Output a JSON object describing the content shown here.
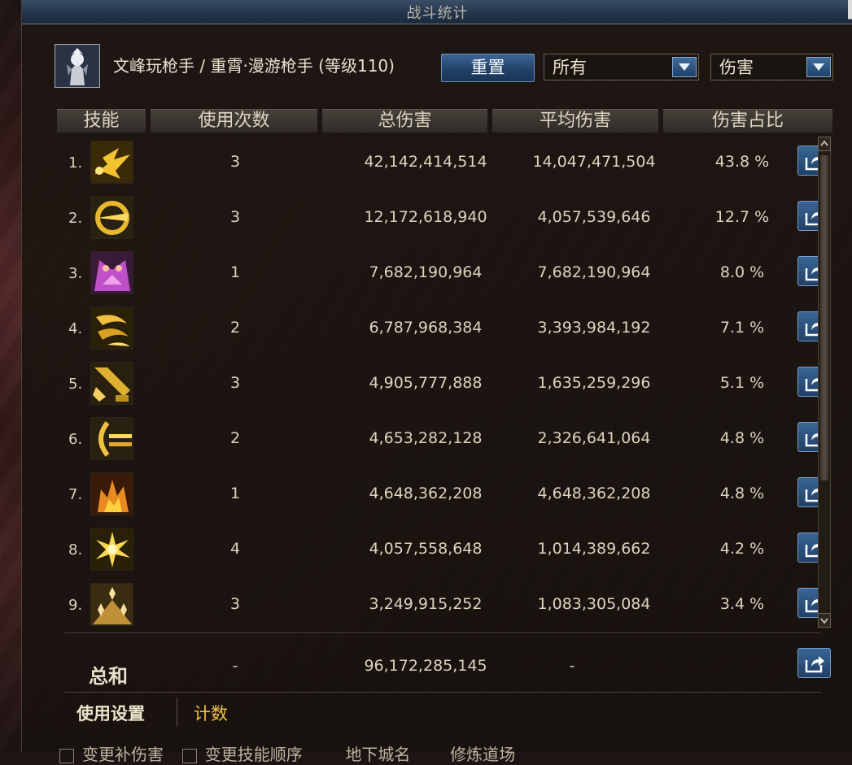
{
  "window": {
    "title": "战斗统计"
  },
  "character": {
    "name": "文峰玩枪手 / 重霄·漫游枪手 (等级110)"
  },
  "toolbar": {
    "reset_label": "重置",
    "filter_select": "所有",
    "metric_select": "伤害"
  },
  "table": {
    "columns": [
      "技能",
      "使用次数",
      "总伤害",
      "平均伤害",
      "伤害占比"
    ],
    "rows": [
      {
        "rank": "1.",
        "count": "3",
        "total": "42,142,414,514",
        "avg": "14,047,471,504",
        "pct": "43.8 %",
        "icon": "skill-burst-icon"
      },
      {
        "rank": "2.",
        "count": "3",
        "total": "12,172,618,940",
        "avg": "4,057,539,646",
        "pct": "12.7 %",
        "icon": "skill-spin-icon"
      },
      {
        "rank": "3.",
        "count": "1",
        "total": "7,682,190,964",
        "avg": "7,682,190,964",
        "pct": "8.0 %",
        "icon": "skill-awaken-icon"
      },
      {
        "rank": "4.",
        "count": "2",
        "total": "6,787,968,384",
        "avg": "3,393,984,192",
        "pct": "7.1 %",
        "icon": "skill-whirl-icon"
      },
      {
        "rank": "5.",
        "count": "3",
        "total": "4,905,777,888",
        "avg": "1,635,259,296",
        "pct": "5.1 %",
        "icon": "skill-cannon-icon"
      },
      {
        "rank": "6.",
        "count": "2",
        "total": "4,653,282,128",
        "avg": "2,326,641,064",
        "pct": "4.8 %",
        "icon": "skill-shot-icon"
      },
      {
        "rank": "7.",
        "count": "1",
        "total": "4,648,362,208",
        "avg": "4,648,362,208",
        "pct": "4.8 %",
        "icon": "skill-flame-icon"
      },
      {
        "rank": "8.",
        "count": "4",
        "total": "4,057,558,648",
        "avg": "1,014,389,662",
        "pct": "4.2 %",
        "icon": "skill-flash-icon"
      },
      {
        "rank": "9.",
        "count": "3",
        "total": "3,249,915,252",
        "avg": "1,083,305,084",
        "pct": "3.4 %",
        "icon": "skill-mine-icon"
      }
    ],
    "summary": {
      "label": "总和",
      "count": "-",
      "total": "96,172,285,145",
      "avg": "-"
    }
  },
  "footer": {
    "tab_settings": "使用设置",
    "tab_count": "计数",
    "options": [
      "变更补伤害",
      "变更技能顺序",
      "地下城名",
      "修炼道场"
    ]
  },
  "colors": {
    "gold_text": "#f0c040",
    "title_bar": "#24364c",
    "button_blue": "#2a4c78"
  }
}
